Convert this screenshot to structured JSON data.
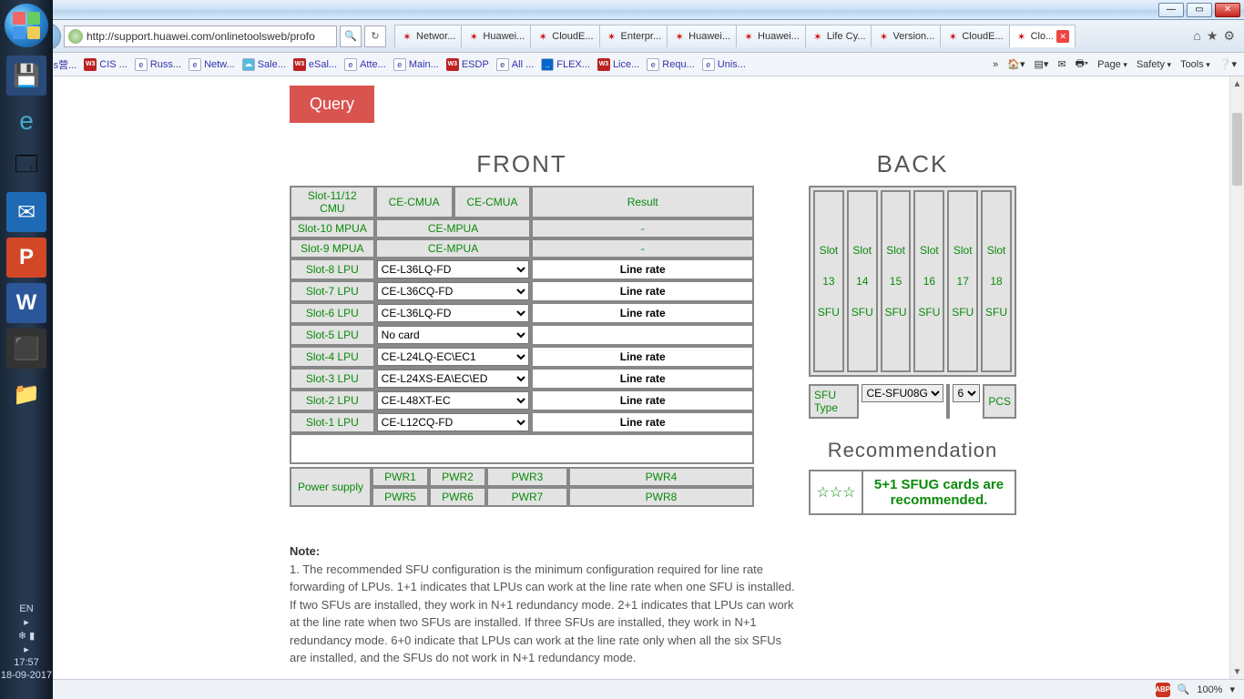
{
  "window": {
    "min": "",
    "max": "",
    "close": ""
  },
  "nav": {
    "url": "http://support.huawei.com/onlinetoolsweb/profo",
    "tabs": [
      {
        "label": "Networ..."
      },
      {
        "label": "Huawei..."
      },
      {
        "label": "CloudE..."
      },
      {
        "label": "Enterpr..."
      },
      {
        "label": "Huawei..."
      },
      {
        "label": "Huawei..."
      },
      {
        "label": "Life Cy..."
      },
      {
        "label": "Version..."
      },
      {
        "label": "CloudE..."
      },
      {
        "label": "Clo...",
        "active": true
      }
    ]
  },
  "favorites": {
    "items": [
      {
        "label": "oss营..."
      },
      {
        "label": "CIS ..."
      },
      {
        "label": "Russ..."
      },
      {
        "label": "Netw..."
      },
      {
        "label": "Sale..."
      },
      {
        "label": "eSal..."
      },
      {
        "label": "Atte..."
      },
      {
        "label": "Main..."
      },
      {
        "label": "ESDP"
      },
      {
        "label": "All ..."
      },
      {
        "label": "FLEX..."
      },
      {
        "label": "Lice..."
      },
      {
        "label": "Requ..."
      },
      {
        "label": "Unis..."
      }
    ],
    "right": [
      "Page",
      "Safety",
      "Tools"
    ]
  },
  "main": {
    "query_label": "Query",
    "front_header": "FRONT",
    "back_header": "BACK",
    "result_header": "Result",
    "slots_fixed": [
      {
        "label": "Slot-11/12 CMU",
        "card1": "CE-CMUA",
        "card2": "CE-CMUA",
        "res": "Result"
      },
      {
        "label": "Slot-10 MPUA",
        "card": "CE-MPUA",
        "res": "-"
      },
      {
        "label": "Slot-9 MPUA",
        "card": "CE-MPUA",
        "res": "-"
      }
    ],
    "lpu": [
      {
        "label": "Slot-8 LPU",
        "sel": "CE-L36LQ-FD",
        "res": "Line rate"
      },
      {
        "label": "Slot-7 LPU",
        "sel": "CE-L36CQ-FD",
        "res": "Line rate"
      },
      {
        "label": "Slot-6 LPU",
        "sel": "CE-L36LQ-FD",
        "res": "Line rate"
      },
      {
        "label": "Slot-5 LPU",
        "sel": "No card",
        "res": ""
      },
      {
        "label": "Slot-4 LPU",
        "sel": "CE-L24LQ-EC\\EC1",
        "res": "Line rate"
      },
      {
        "label": "Slot-3 LPU",
        "sel": "CE-L24XS-EA\\EC\\ED",
        "res": "Line rate"
      },
      {
        "label": "Slot-2 LPU",
        "sel": "CE-L48XT-EC",
        "res": "Line rate"
      },
      {
        "label": "Slot-1 LPU",
        "sel": "CE-L12CQ-FD",
        "res": "Line rate"
      }
    ],
    "power_label": "Power supply",
    "pwr": [
      "PWR1",
      "PWR2",
      "PWR3",
      "PWR4",
      "PWR5",
      "PWR6",
      "PWR7",
      "PWR8"
    ],
    "back_slots": [
      {
        "slot": "Slot",
        "n": "13",
        "t": "SFU"
      },
      {
        "slot": "Slot",
        "n": "14",
        "t": "SFU"
      },
      {
        "slot": "Slot",
        "n": "15",
        "t": "SFU"
      },
      {
        "slot": "Slot",
        "n": "16",
        "t": "SFU"
      },
      {
        "slot": "Slot",
        "n": "17",
        "t": "SFU"
      },
      {
        "slot": "Slot",
        "n": "18",
        "t": "SFU"
      }
    ],
    "sfu_type_label": "SFU Type",
    "sfu_type": "CE-SFU08G",
    "sfu_qty": "6",
    "sfu_pcs": "PCS",
    "rec_header": "Recommendation",
    "rec_text": "5+1 SFUG cards are recommended.",
    "note_header": "Note:",
    "note_body": "1. The recommended SFU configuration is the minimum configuration required for line rate forwarding of LPUs. 1+1 indicates that LPUs can work at the line rate when one SFU is installed. If two SFUs are installed, they work in N+1 redundancy mode. 2+1 indicates that LPUs can work at the line rate when two SFUs are installed. If three SFUs are installed, they work in N+1 redundancy mode. 6+0 indicate that LPUs can work at the line rate only when all the six SFUs are installed, and the SFUs do not work in N+1 redundancy mode."
  },
  "taskbar": {
    "lang": "EN",
    "time": "17:57",
    "date": "18-09-2017"
  },
  "status": {
    "zoom": "100%"
  }
}
